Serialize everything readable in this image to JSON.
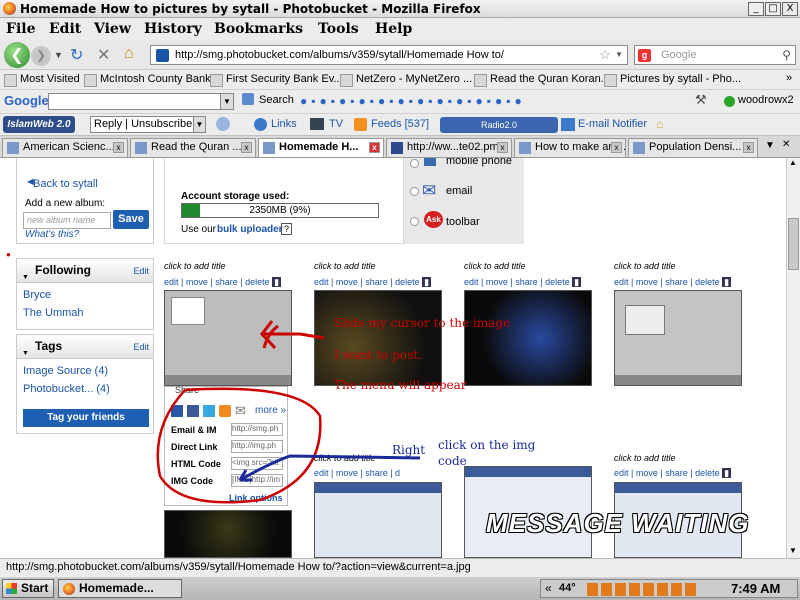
{
  "window": {
    "title": "Homemade How to pictures by sytall - Photobucket - Mozilla Firefox",
    "controls": [
      "_",
      "□",
      "X"
    ]
  },
  "menu": [
    "File",
    "Edit",
    "View",
    "History",
    "Bookmarks",
    "Tools",
    "Help"
  ],
  "nav": {
    "url": "http://smg.photobucket.com/albums/v359/sytall/Homemade How to/",
    "search_placeholder": "Google"
  },
  "bookmarks": [
    "Most Visited",
    "McIntosh County Bank",
    "First Security Bank Ev...",
    "NetZero - MyNetZero ...",
    "Read the Quran Koran...",
    "Pictures by sytall - Pho..."
  ],
  "google_toolbar": {
    "logo": "Google",
    "search_label": "Search",
    "user": "woodrowx2"
  },
  "islam_toolbar": {
    "logo": "IslamWeb 2.0",
    "reply": "Reply | Unsubscribe",
    "links": "Links",
    "tv": "TV",
    "feeds": "Feeds [537]",
    "radio": "Radio2.0",
    "email_notifier": "E-mail Notifier"
  },
  "tabs": [
    {
      "label": "American Scienc...",
      "active": false
    },
    {
      "label": "Read the Quran ...",
      "active": false
    },
    {
      "label": "Homemade H...",
      "active": true
    },
    {
      "label": "http://ww...te02.pm",
      "active": false
    },
    {
      "label": "How to make ani...",
      "active": false
    },
    {
      "label": "Population Densi...",
      "active": false
    }
  ],
  "sidebar": {
    "back_link": "Back to sytall",
    "add_album_label": "Add a new album:",
    "album_placeholder": "new album name",
    "save_button": "Save",
    "whats_this": "What's this?",
    "following": {
      "title": "Following",
      "edit": "Edit",
      "items": [
        "Bryce",
        "The Ummah"
      ]
    },
    "tags": {
      "title": "Tags",
      "edit": "Edit",
      "items": [
        "Image Source (4)",
        "Photobucket... (4)"
      ],
      "button": "Tag your friends"
    }
  },
  "storage": {
    "label": "Account storage used:",
    "value": "2350MB (9%)",
    "percent": 9,
    "uploader_prefix": "Use our",
    "uploader_link": "bulk uploader",
    "help": "?"
  },
  "share_options": [
    "mobile phone",
    "email",
    "toolbar"
  ],
  "thumbnails": {
    "caption": "click to add title",
    "actions": [
      "edit",
      "move",
      "share",
      "delete"
    ],
    "row2_actions_partial": "edit | move | share | d"
  },
  "share_popup": {
    "title": "Share",
    "more": "more »",
    "rows": [
      {
        "label": "Email & IM",
        "value": "http://smg.ph"
      },
      {
        "label": "Direct Link",
        "value": "http://img.ph"
      },
      {
        "label": "HTML Code",
        "value": "<img src=\"htt"
      },
      {
        "label": "IMG Code",
        "value": "[IMG]http://im"
      }
    ],
    "link_options": "Link options"
  },
  "annotations": {
    "line1": "Slide my cursor to the image",
    "line2": "I want to post.",
    "line3": "The menu will appear",
    "right": "Right",
    "click1": "click on the img",
    "click2": "code"
  },
  "overlay": "MESSAGE WAITING",
  "status_url": "http://smg.photobucket.com/albums/v359/sytall/Homemade How to/?action=view&current=a.jpg",
  "taskbar": {
    "start": "Start",
    "task": "Homemade...",
    "temp": "44°",
    "clock": "7:49 AM"
  },
  "colors": {
    "link": "#1a55a8",
    "annotation": "#cc0000",
    "save_button": "#1e5fb4",
    "storage_fill": "#1f8a2e"
  }
}
